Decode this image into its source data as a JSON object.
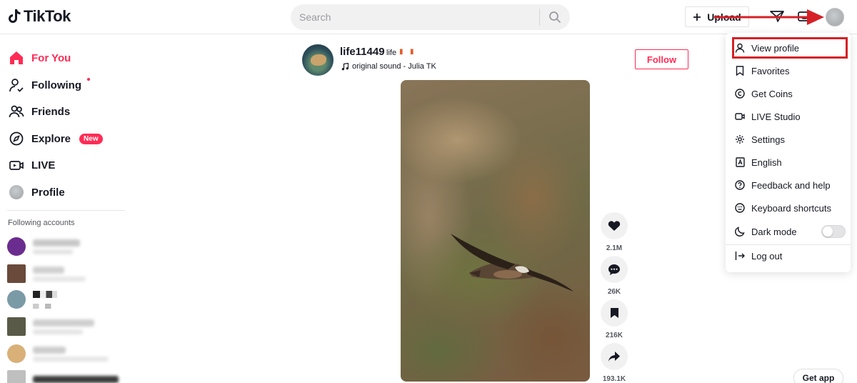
{
  "header": {
    "logo_text": "TikTok",
    "search_placeholder": "Search",
    "upload_label": "Upload"
  },
  "sidebar": {
    "nav": [
      {
        "label": "For You",
        "icon": "home-icon",
        "active": true
      },
      {
        "label": "Following",
        "icon": "following-icon",
        "active": false
      },
      {
        "label": "Friends",
        "icon": "friends-icon",
        "active": false
      },
      {
        "label": "Explore",
        "icon": "compass-icon",
        "active": false,
        "badge": "New"
      },
      {
        "label": "LIVE",
        "icon": "live-icon",
        "active": false
      },
      {
        "label": "Profile",
        "icon": "avatar-icon",
        "active": false
      }
    ],
    "following_accounts_title": "Following accounts"
  },
  "post": {
    "username": "life11449",
    "nickname": "life",
    "sound": "original sound - Julia TK",
    "follow_label": "Follow",
    "likes": "2.1M",
    "comments": "26K",
    "saves": "216K",
    "shares": "193.1K"
  },
  "menu": {
    "items": [
      {
        "label": "View profile",
        "icon": "user-icon"
      },
      {
        "label": "Favorites",
        "icon": "bookmark-icon"
      },
      {
        "label": "Get Coins",
        "icon": "coin-icon"
      },
      {
        "label": "LIVE Studio",
        "icon": "live-studio-icon"
      },
      {
        "label": "Settings",
        "icon": "gear-icon"
      },
      {
        "label": "English",
        "icon": "language-icon"
      },
      {
        "label": "Feedback and help",
        "icon": "help-icon"
      },
      {
        "label": "Keyboard shortcuts",
        "icon": "keyboard-icon"
      },
      {
        "label": "Dark mode",
        "icon": "moon-icon"
      },
      {
        "label": "Log out",
        "icon": "logout-icon"
      }
    ]
  },
  "get_app_label": "Get app",
  "colors": {
    "brand": "#fe2c55",
    "annotation_red": "#d62027"
  }
}
